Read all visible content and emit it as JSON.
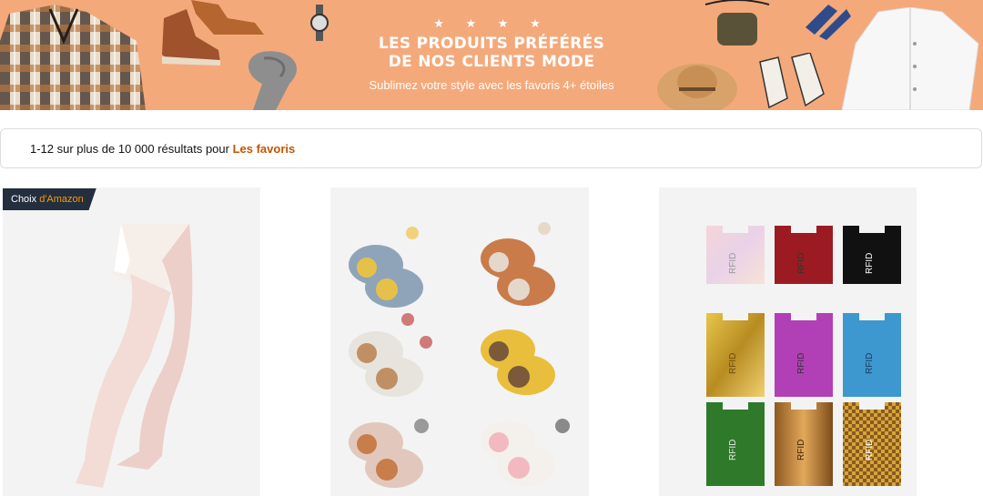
{
  "banner": {
    "stars": "★ ★ ★ ★",
    "title_line1": "LES PRODUITS PRÉFÉRÉS",
    "title_line2": "DE NOS CLIENTS MODE",
    "subtitle": "Sublimez votre style avec les favoris 4+ étoiles"
  },
  "results": {
    "count_text": "1-12 sur plus de 10 000 résultats pour ",
    "query": "Les favoris"
  },
  "badge": {
    "prefix": "Choix ",
    "brand": "d'Amazon"
  },
  "products": [
    {
      "name": "tights"
    },
    {
      "name": "baby-shoes"
    },
    {
      "name": "rfid-sleeves",
      "card_label": "RFID"
    }
  ]
}
